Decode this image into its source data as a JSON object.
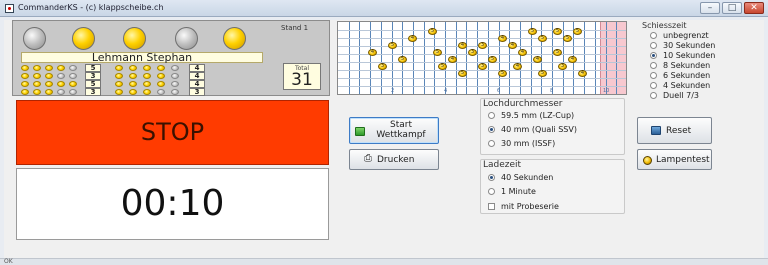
{
  "window": {
    "title": "CommanderKS  -  (c) klappscheibe.ch"
  },
  "status_bar": {
    "text": "OK"
  },
  "shooter": {
    "stand_label": "Stand 1",
    "name": "Lehmann Stephan",
    "total_label": "Total",
    "total_value": "31",
    "lamps": [
      "off",
      "on",
      "on",
      "off",
      "on"
    ],
    "series": [
      {
        "left_yellow": 4,
        "left_count": "5",
        "right_yellow": 4,
        "right_count": "4"
      },
      {
        "left_yellow": 3,
        "left_count": "3",
        "right_yellow": 4,
        "right_count": "4"
      },
      {
        "left_yellow": 5,
        "left_count": "5",
        "right_yellow": 4,
        "right_count": "4"
      },
      {
        "left_yellow": 3,
        "left_count": "3",
        "right_yellow": 3,
        "right_count": "3"
      }
    ]
  },
  "grid": {
    "x_numbers": [
      "2",
      "4",
      "6",
      "8",
      "10"
    ],
    "shots": [
      "5",
      "5",
      "5",
      "5",
      "4",
      "4",
      "5",
      "5",
      "5",
      "4",
      "3",
      "4",
      "4",
      "5",
      "3",
      "4",
      "5",
      "5",
      "4",
      "5",
      "4",
      "4",
      "3",
      "5",
      "3",
      "4",
      "3",
      "5",
      "5",
      "5",
      "4"
    ]
  },
  "status": {
    "text": "STOP",
    "color": "#ff3b00"
  },
  "timer": {
    "value": "00:10"
  },
  "buttons": {
    "start": "Start Wettkampf",
    "print": "Drucken",
    "reset": "Reset",
    "lamptest": "Lampentest"
  },
  "lochdurchmesser": {
    "title": "Lochdurchmesser",
    "options": [
      {
        "label": "59.5 mm (LZ-Cup)",
        "selected": false
      },
      {
        "label": "40 mm (Quali SSV)",
        "selected": true
      },
      {
        "label": "30 mm (ISSF)",
        "selected": false
      }
    ]
  },
  "ladezeit": {
    "title": "Ladezeit",
    "options": [
      {
        "label": "40 Sekunden",
        "selected": true
      },
      {
        "label": "1 Minute",
        "selected": false
      }
    ],
    "probeserie_label": "mit Probeserie",
    "probeserie_checked": false
  },
  "schiesszeit": {
    "title": "Schiesszeit",
    "options": [
      {
        "label": "unbegrenzt",
        "selected": false
      },
      {
        "label": "30 Sekunden",
        "selected": false
      },
      {
        "label": "10 Sekunden",
        "selected": true
      },
      {
        "label": "8 Sekunden",
        "selected": false
      },
      {
        "label": "6 Sekunden",
        "selected": false
      },
      {
        "label": "4 Sekunden",
        "selected": false
      },
      {
        "label": "Duell 7/3",
        "selected": false
      }
    ]
  },
  "colors": {
    "accent": "#3d7bc6",
    "stop_red": "#ff3b00",
    "lamp_yellow": "#ffd100"
  }
}
